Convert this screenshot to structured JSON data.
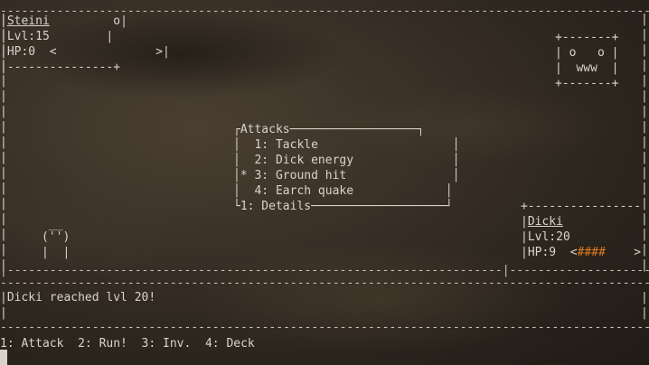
{
  "player": {
    "name": "Steini",
    "name_line_suffix": "         o",
    "level": "Lvl:15",
    "hp_line": "HP:0  <              >"
  },
  "enemy": {
    "name": "Dicki",
    "level": "Lvl:20",
    "hp_label": "HP:9  <",
    "hp_bar": "####",
    "hp_end": "    >"
  },
  "enemy_portrait": {
    "top": "+-------+",
    "eyes": "| o   o |",
    "mouth": "|  www  |",
    "bottom": "+-------+"
  },
  "player_sprite": {
    "line1": " __",
    "line2": "('')",
    "line3": "|  |"
  },
  "attacks_menu": {
    "title": "Attacks",
    "items": [
      {
        "label": "  1: Tackle"
      },
      {
        "label": "  2: Dick energy"
      },
      {
        "label": "* 3: Ground hit"
      },
      {
        "label": "  4: Earch quake"
      }
    ],
    "footer": "1: Details"
  },
  "message": "Dicki reached lvl 20!",
  "commands": "1: Attack  2: Run!  3: Inv.  4: Deck",
  "colors": {
    "hp_bar": "#e07a1f",
    "text": "#d8d4cc"
  }
}
